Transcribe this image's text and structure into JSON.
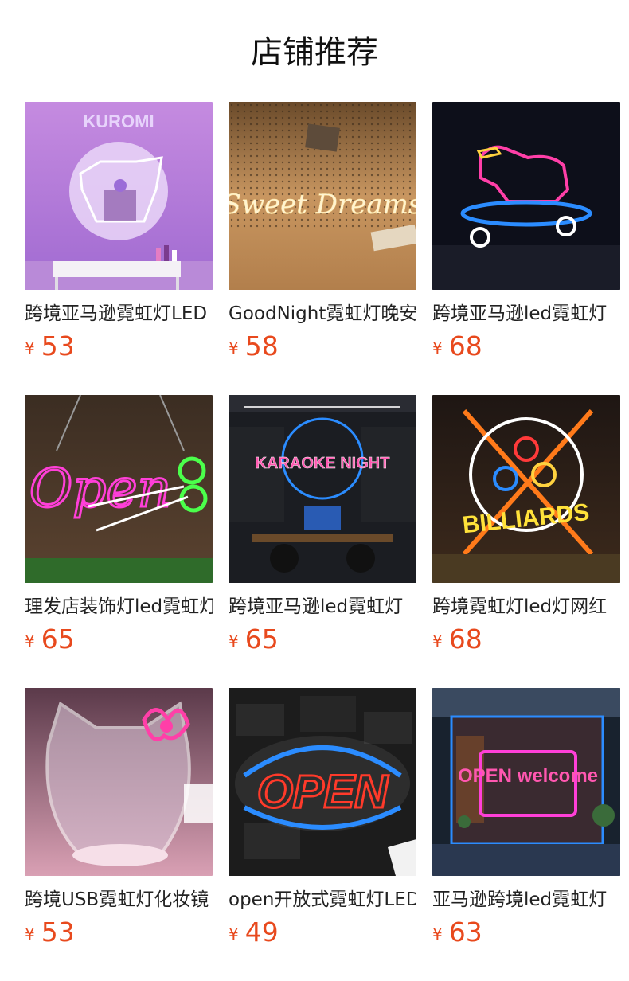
{
  "header": {
    "title": "店铺推荐"
  },
  "products": [
    {
      "name": "跨境亚马逊霓虹灯LED",
      "currency": "¥",
      "price": "53",
      "image_icon": "kuromi-mirror-neon-icon",
      "image_text": "KUROMI"
    },
    {
      "name": "GoodNight霓虹灯晚安",
      "currency": "¥",
      "price": "58",
      "image_icon": "sweet-dreams-neon-icon",
      "image_text": "Sweet Dreams"
    },
    {
      "name": "跨境亚马逊led霓虹灯",
      "currency": "¥",
      "price": "68",
      "image_icon": "skateboard-dog-neon-icon",
      "image_text": ""
    },
    {
      "name": "理发店装饰灯led霓虹灯",
      "currency": "¥",
      "price": "65",
      "image_icon": "open-scissors-neon-icon",
      "image_text": "Open"
    },
    {
      "name": "跨境亚马逊led霓虹灯",
      "currency": "¥",
      "price": "65",
      "image_icon": "karaoke-night-neon-icon",
      "image_text": "KARAOKE NIGHT"
    },
    {
      "name": "跨境霓虹灯led灯网红",
      "currency": "¥",
      "price": "68",
      "image_icon": "billiards-neon-icon",
      "image_text": "BILLIARDS"
    },
    {
      "name": "跨境USB霓虹灯化妆镜",
      "currency": "¥",
      "price": "53",
      "image_icon": "hello-kitty-mirror-neon-icon",
      "image_text": ""
    },
    {
      "name": "open开放式霓虹灯LED",
      "currency": "¥",
      "price": "49",
      "image_icon": "open-sign-neon-icon",
      "image_text": "OPEN"
    },
    {
      "name": "亚马逊跨境led霓虹灯",
      "currency": "¥",
      "price": "63",
      "image_icon": "open-welcome-neon-icon",
      "image_text": "OPEN welcome"
    }
  ],
  "colors": {
    "price": "#e8491d",
    "title": "#111111",
    "name": "#222222"
  }
}
